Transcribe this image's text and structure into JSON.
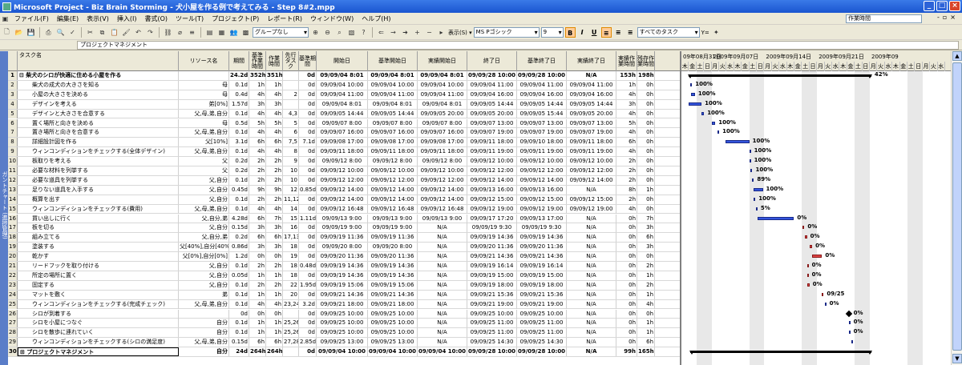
{
  "window": {
    "title": "Microsoft Project - Biz Brain Storming - 犬小屋を作る例で考えてみる - Step 8#2.mpp"
  },
  "menu": {
    "items": [
      "ファイル(F)",
      "編集(E)",
      "表示(V)",
      "挿入(I)",
      "書式(O)",
      "ツール(T)",
      "プロジェクト(P)",
      "レポート(R)",
      "ウィンドウ(W)",
      "ヘルプ(H)"
    ],
    "help_box": "作業時間"
  },
  "toolbar": {
    "group_combo": "グループなし",
    "view_label": "表示(S) ▾",
    "font_combo": "MS Pゴシック",
    "size_combo": "9",
    "bold_label": "B",
    "italic_label": "I",
    "underline_label": "U",
    "filter_combo": "すべてのタスク",
    "filter_suffix": "Y="
  },
  "entry_bar": {
    "value": "プロジェクトマネジメント"
  },
  "view_bar": {
    "label": "ガントチャート (進捗管理)"
  },
  "columns": [
    {
      "label": "",
      "width": 12
    },
    {
      "label": "タスク名",
      "width": 201
    },
    {
      "label": "リソース名",
      "width": 63
    },
    {
      "label": "期間",
      "width": 25
    },
    {
      "label": "基準作業時間",
      "width": 21
    },
    {
      "label": "作業時間",
      "width": 21
    },
    {
      "label": "先行タスク",
      "width": 20
    },
    {
      "label": "基準期間",
      "width": 22
    },
    {
      "label": "開始日",
      "width": 64
    },
    {
      "label": "基準開始日",
      "width": 62
    },
    {
      "label": "実績開始日",
      "width": 62
    },
    {
      "label": "終了日",
      "width": 62
    },
    {
      "label": "基準終了日",
      "width": 62
    },
    {
      "label": "実績終了日",
      "width": 62
    },
    {
      "label": "実績作業時間",
      "width": 26
    },
    {
      "label": "残存作業時間",
      "width": 22
    }
  ],
  "rows": [
    {
      "id": "1",
      "name": "⊟ 柴犬のシロが快適に住める小屋を作る",
      "res": "",
      "dur": "24.2d",
      "bw": "352h",
      "work": "351h",
      "pred": "",
      "bdur": "0d",
      "start": "09/09/04 8:01",
      "bstart": "09/09/04 8:01",
      "astart": "09/09/04 8:01",
      "finish": "09/09/28 10:00",
      "bfinish": "09/09/28 10:00",
      "afinish": "N/A",
      "awork": "153h",
      "rwork": "198h",
      "bold": true
    },
    {
      "id": "2",
      "name": "柴犬の成犬の大きさを知る",
      "res": "母",
      "dur": "0.1d",
      "bw": "1h",
      "work": "1h",
      "pred": "",
      "bdur": "0d",
      "start": "09/09/04 10:00",
      "bstart": "09/09/04 10:00",
      "astart": "09/09/04 10:00",
      "finish": "09/09/04 11:00",
      "bfinish": "09/09/04 11:00",
      "afinish": "09/09/04 11:00",
      "awork": "1h",
      "rwork": "0h"
    },
    {
      "id": "3",
      "name": "小屋の大きさを決める",
      "res": "母",
      "dur": "0.4d",
      "bw": "4h",
      "work": "4h",
      "pred": "2",
      "bdur": "0d",
      "start": "09/09/04 11:00",
      "bstart": "09/09/04 11:00",
      "astart": "09/09/04 11:00",
      "finish": "09/09/04 16:00",
      "bfinish": "09/09/04 16:00",
      "afinish": "09/09/04 16:00",
      "awork": "4h",
      "rwork": "0h"
    },
    {
      "id": "4",
      "name": "デザインを考える",
      "res": "弟[0%]",
      "dur": "1.57d",
      "bw": "3h",
      "work": "3h",
      "pred": "",
      "bdur": "0d",
      "start": "09/09/04 8:01",
      "bstart": "09/09/04 8:01",
      "astart": "09/09/04 8:01",
      "finish": "09/09/05 14:44",
      "bfinish": "09/09/05 14:44",
      "afinish": "09/09/05 14:44",
      "awork": "3h",
      "rwork": "0h"
    },
    {
      "id": "5",
      "name": "デザインと大きさを合意する",
      "res": "父,母,弟,自分",
      "dur": "0.1d",
      "bw": "4h",
      "work": "4h",
      "pred": "4,3",
      "bdur": "0d",
      "start": "09/09/05 14:44",
      "bstart": "09/09/05 14:44",
      "astart": "09/09/05 20:00",
      "finish": "09/09/05 20:00",
      "bfinish": "09/09/05 15:44",
      "afinish": "09/09/05 20:00",
      "awork": "4h",
      "rwork": "0h"
    },
    {
      "id": "6",
      "name": "置く場所と向きを決める",
      "res": "母",
      "dur": "0.5d",
      "bw": "5h",
      "work": "5h",
      "pred": "5",
      "bdur": "0d",
      "start": "09/09/07 8:00",
      "bstart": "09/09/07 8:00",
      "astart": "09/09/07 8:00",
      "finish": "09/09/07 13:00",
      "bfinish": "09/09/07 13:00",
      "afinish": "09/09/07 13:00",
      "awork": "5h",
      "rwork": "0h"
    },
    {
      "id": "7",
      "name": "置き場所と向きを合意する",
      "res": "父,母,弟,自分",
      "dur": "0.1d",
      "bw": "4h",
      "work": "4h",
      "pred": "6",
      "bdur": "0d",
      "start": "09/09/07 16:00",
      "bstart": "09/09/07 16:00",
      "astart": "09/09/07 16:00",
      "finish": "09/09/07 19:00",
      "bfinish": "09/09/07 19:00",
      "afinish": "09/09/07 19:00",
      "awork": "4h",
      "rwork": "0h"
    },
    {
      "id": "8",
      "name": "詳細設計図を作る",
      "res": "父[10%]",
      "dur": "3.1d",
      "bw": "6h",
      "work": "6h",
      "pred": "7,5",
      "bdur": "7.1d",
      "start": "09/09/08 17:00",
      "bstart": "09/09/08 17:00",
      "astart": "09/09/08 17:00",
      "finish": "09/09/11 18:00",
      "bfinish": "09/09/10 18:00",
      "afinish": "09/09/11 18:00",
      "awork": "6h",
      "rwork": "0h"
    },
    {
      "id": "9",
      "name": "ウィンコンディションをチェックする(全体デザイン)",
      "res": "父,母,弟,自分",
      "dur": "0.1d",
      "bw": "4h",
      "work": "4h",
      "pred": "8",
      "bdur": "0d",
      "start": "09/09/11 18:00",
      "bstart": "09/09/11 18:00",
      "astart": "09/09/11 18:00",
      "finish": "09/09/11 19:00",
      "bfinish": "09/09/11 19:00",
      "afinish": "09/09/11 19:00",
      "awork": "4h",
      "rwork": "0h"
    },
    {
      "id": "10",
      "name": "板取りを考える",
      "res": "父",
      "dur": "0.2d",
      "bw": "2h",
      "work": "2h",
      "pred": "9",
      "bdur": "0d",
      "start": "09/09/12 8:00",
      "bstart": "09/09/12 8:00",
      "astart": "09/09/12 8:00",
      "finish": "09/09/12 10:00",
      "bfinish": "09/09/12 10:00",
      "afinish": "09/09/12 10:00",
      "awork": "2h",
      "rwork": "0h"
    },
    {
      "id": "11",
      "name": "必要な材料を列挙する",
      "res": "父",
      "dur": "0.2d",
      "bw": "2h",
      "work": "2h",
      "pred": "10",
      "bdur": "0d",
      "start": "09/09/12 10:00",
      "bstart": "09/09/12 10:00",
      "astart": "09/09/12 10:00",
      "finish": "09/09/12 12:00",
      "bfinish": "09/09/12 12:00",
      "afinish": "09/09/12 12:00",
      "awork": "2h",
      "rwork": "0h"
    },
    {
      "id": "12",
      "name": "必要な道具を列挙する",
      "res": "父,自分",
      "dur": "0.1d",
      "bw": "2h",
      "work": "2h",
      "pred": "10",
      "bdur": "0d",
      "start": "09/09/12 12:00",
      "bstart": "09/09/12 12:00",
      "astart": "09/09/12 12:00",
      "finish": "09/09/12 14:00",
      "bfinish": "09/09/12 14:00",
      "afinish": "09/09/12 14:00",
      "awork": "2h",
      "rwork": "0h"
    },
    {
      "id": "13",
      "name": "足りない道具を入手する",
      "res": "父,自分",
      "dur": "0.45d",
      "bw": "9h",
      "work": "9h",
      "pred": "12",
      "bdur": "0.85d",
      "start": "09/09/12 14:00",
      "bstart": "09/09/12 14:00",
      "astart": "09/09/12 14:00",
      "finish": "09/09/13 16:00",
      "bfinish": "09/09/13 16:00",
      "afinish": "N/A",
      "awork": "8h",
      "rwork": "1h"
    },
    {
      "id": "14",
      "name": "概算を出す",
      "res": "父,自分",
      "dur": "0.1d",
      "bw": "2h",
      "work": "2h",
      "pred": "11,12",
      "bdur": "0d",
      "start": "09/09/12 14:00",
      "bstart": "09/09/12 14:00",
      "astart": "09/09/12 14:00",
      "finish": "09/09/12 15:00",
      "bfinish": "09/09/12 15:00",
      "afinish": "09/09/12 15:00",
      "awork": "2h",
      "rwork": "0h"
    },
    {
      "id": "15",
      "name": "ウィンコンディションをチェックする(費用)",
      "res": "父,母,弟,自分",
      "dur": "0.1d",
      "bw": "4h",
      "work": "4h",
      "pred": "14",
      "bdur": "0d",
      "start": "09/09/12 16:48",
      "bstart": "09/09/12 16:48",
      "astart": "09/09/12 16:48",
      "finish": "09/09/12 19:00",
      "bfinish": "09/09/12 19:00",
      "afinish": "09/09/12 19:00",
      "awork": "4h",
      "rwork": "0h"
    },
    {
      "id": "16",
      "name": "買い出しに行く",
      "res": "父,自分,弟",
      "dur": "4.28d",
      "bw": "6h",
      "work": "7h",
      "pred": "15",
      "bdur": "1.11d",
      "start": "09/09/13 9:00",
      "bstart": "09/09/13 9:00",
      "astart": "09/09/13 9:00",
      "finish": "09/09/17 17:20",
      "bfinish": "09/09/13 17:00",
      "afinish": "N/A",
      "awork": "0h",
      "rwork": "7h"
    },
    {
      "id": "17",
      "name": "板を切る",
      "res": "父,自分",
      "dur": "0.15d",
      "bw": "3h",
      "work": "3h",
      "pred": "16",
      "bdur": "0d",
      "start": "09/09/19 9:00",
      "bstart": "09/09/19 9:00",
      "astart": "N/A",
      "finish": "09/09/19 9:30",
      "bfinish": "09/09/19 9:30",
      "afinish": "N/A",
      "awork": "0h",
      "rwork": "3h"
    },
    {
      "id": "18",
      "name": "組み立てる",
      "res": "父,自分,弟",
      "dur": "0.2d",
      "bw": "6h",
      "work": "6h",
      "pred": "17,13",
      "bdur": "0d",
      "start": "09/09/19 11:36",
      "bstart": "09/09/19 11:36",
      "astart": "N/A",
      "finish": "09/09/19 14:36",
      "bfinish": "09/09/19 14:36",
      "afinish": "N/A",
      "awork": "0h",
      "rwork": "6h"
    },
    {
      "id": "19",
      "name": "塗装する",
      "res": "父[40%],自分[40%]",
      "dur": "0.86d",
      "bw": "3h",
      "work": "3h",
      "pred": "18",
      "bdur": "0d",
      "start": "09/09/20 8:00",
      "bstart": "09/09/20 8:00",
      "astart": "N/A",
      "finish": "09/09/20 11:36",
      "bfinish": "09/09/20 11:36",
      "afinish": "N/A",
      "awork": "0h",
      "rwork": "3h"
    },
    {
      "id": "20",
      "name": "乾かす",
      "res": "父[0%],自分[0%]",
      "dur": "1.2d",
      "bw": "0h",
      "work": "0h",
      "pred": "19",
      "bdur": "0d",
      "start": "09/09/20 11:36",
      "bstart": "09/09/20 11:36",
      "astart": "N/A",
      "finish": "09/09/21 14:36",
      "bfinish": "09/09/21 14:36",
      "afinish": "N/A",
      "awork": "0h",
      "rwork": "0h"
    },
    {
      "id": "21",
      "name": "リードフックを取り付ける",
      "res": "父,自分",
      "dur": "0.1d",
      "bw": "2h",
      "work": "2h",
      "pred": "18",
      "bdur": "0.48d",
      "start": "09/09/19 14:36",
      "bstart": "09/09/19 14:36",
      "astart": "N/A",
      "finish": "09/09/19 16:14",
      "bfinish": "09/09/19 16:14",
      "afinish": "N/A",
      "awork": "0h",
      "rwork": "2h"
    },
    {
      "id": "22",
      "name": "所定の場所に置く",
      "res": "父,自分",
      "dur": "0.05d",
      "bw": "1h",
      "work": "1h",
      "pred": "18",
      "bdur": "0d",
      "start": "09/09/19 14:36",
      "bstart": "09/09/19 14:36",
      "astart": "N/A",
      "finish": "09/09/19 15:00",
      "bfinish": "09/09/19 15:00",
      "afinish": "N/A",
      "awork": "0h",
      "rwork": "1h"
    },
    {
      "id": "23",
      "name": "固定する",
      "res": "父,自分",
      "dur": "0.1d",
      "bw": "2h",
      "work": "2h",
      "pred": "22",
      "bdur": "1.95d",
      "start": "09/09/19 15:06",
      "bstart": "09/09/19 15:06",
      "astart": "N/A",
      "finish": "09/09/19 18:00",
      "bfinish": "09/09/19 18:00",
      "afinish": "N/A",
      "awork": "0h",
      "rwork": "2h"
    },
    {
      "id": "24",
      "name": "マットを敷く",
      "res": "弟",
      "dur": "0.1d",
      "bw": "1h",
      "work": "1h",
      "pred": "20",
      "bdur": "0d",
      "start": "09/09/21 14:36",
      "bstart": "09/09/21 14:36",
      "astart": "N/A",
      "finish": "09/09/21 15:36",
      "bfinish": "09/09/21 15:36",
      "afinish": "N/A",
      "awork": "0h",
      "rwork": "1h"
    },
    {
      "id": "25",
      "name": "ウィンコンディションをチェックする(完成チェック)",
      "res": "父,母,弟,自分",
      "dur": "0.1d",
      "bw": "4h",
      "work": "4h",
      "pred": "23,24",
      "bdur": "3.2d",
      "start": "09/09/21 18:00",
      "bstart": "09/09/21 18:00",
      "astart": "N/A",
      "finish": "09/09/21 19:00",
      "bfinish": "09/09/21 19:00",
      "afinish": "N/A",
      "awork": "0h",
      "rwork": "4h"
    },
    {
      "id": "26",
      "name": "シロが到着する",
      "res": "",
      "dur": "0d",
      "bw": "0h",
      "work": "0h",
      "pred": "",
      "bdur": "0d",
      "start": "09/09/25 10:00",
      "bstart": "09/09/25 10:00",
      "astart": "N/A",
      "finish": "09/09/25 10:00",
      "bfinish": "09/09/25 10:00",
      "afinish": "N/A",
      "awork": "0h",
      "rwork": "0h"
    },
    {
      "id": "27",
      "name": "シロを小屋につなぐ",
      "res": "自分",
      "dur": "0.1d",
      "bw": "1h",
      "work": "1h",
      "pred": "25,26",
      "bdur": "0d",
      "start": "09/09/25 10:00",
      "bstart": "09/09/25 10:00",
      "astart": "N/A",
      "finish": "09/09/25 11:00",
      "bfinish": "09/09/25 11:00",
      "afinish": "N/A",
      "awork": "0h",
      "rwork": "1h"
    },
    {
      "id": "28",
      "name": "シロを散歩に連れていく",
      "res": "自分",
      "dur": "0.1d",
      "bw": "1h",
      "work": "1h",
      "pred": "25,26",
      "bdur": "0d",
      "start": "09/09/25 10:00",
      "bstart": "09/09/25 10:00",
      "astart": "N/A",
      "finish": "09/09/25 11:00",
      "bfinish": "09/09/25 11:00",
      "afinish": "N/A",
      "awork": "0h",
      "rwork": "1h"
    },
    {
      "id": "29",
      "name": "ウィンコンディションをチェックする(シロの満足度)",
      "res": "父,母,弟,自分",
      "dur": "0.15d",
      "bw": "6h",
      "work": "6h",
      "pred": "27,28",
      "bdur": "2.85d",
      "start": "09/09/25 13:00",
      "bstart": "09/09/25 13:00",
      "astart": "N/A",
      "finish": "09/09/25 14:30",
      "bfinish": "09/09/25 14:30",
      "afinish": "N/A",
      "awork": "0h",
      "rwork": "6h"
    },
    {
      "id": "30",
      "name": "⊞ プロジェクトマネジメント",
      "res": "自分",
      "dur": "24d",
      "bw": "264h",
      "work": "264h",
      "pred": "",
      "bdur": "0d",
      "start": "09/09/04 10:00",
      "bstart": "09/09/04 10:00",
      "astart": "09/09/04 10:00",
      "finish": "09/09/28 10:00",
      "bfinish": "09/09/28 10:00",
      "afinish": "N/A",
      "awork": "99h",
      "rwork": "165h",
      "bold": true,
      "selected": true
    }
  ],
  "gantt": {
    "weeks": [
      "09年08月31日",
      "2009年09月07日",
      "2009年09月14日",
      "2009年09月21日",
      "2009年09"
    ],
    "days": [
      "木",
      "金",
      "土",
      "日",
      "月",
      "火",
      "水",
      "木",
      "金",
      "土",
      "日",
      "月",
      "火",
      "水",
      "木",
      "金",
      "土",
      "日",
      "月",
      "火",
      "水",
      "木",
      "金",
      "土",
      "日",
      "月",
      "火",
      "水",
      "木",
      "金",
      "土",
      "日",
      "月",
      "火",
      "水"
    ],
    "first_day_offset": 0,
    "pct_labels": [
      "42%",
      "100%",
      "100%",
      "100%",
      "100%",
      "100%",
      "100%",
      "100%",
      "100%",
      "100%",
      "100%",
      "89%",
      "100%",
      "100%",
      "5%",
      "0%",
      "0%",
      "0%",
      "0%",
      "0%",
      "0%",
      "0%",
      "0%",
      "09/25",
      "0%",
      "0%",
      "0%",
      "0%"
    ],
    "milestone_label": "09/25",
    "summary2_label": "0%"
  },
  "colors": {
    "task_bar": "#3355dd",
    "critical_bar": "#dd4444",
    "summary_bar": "#000000",
    "title_bar": "#1a55d0"
  }
}
